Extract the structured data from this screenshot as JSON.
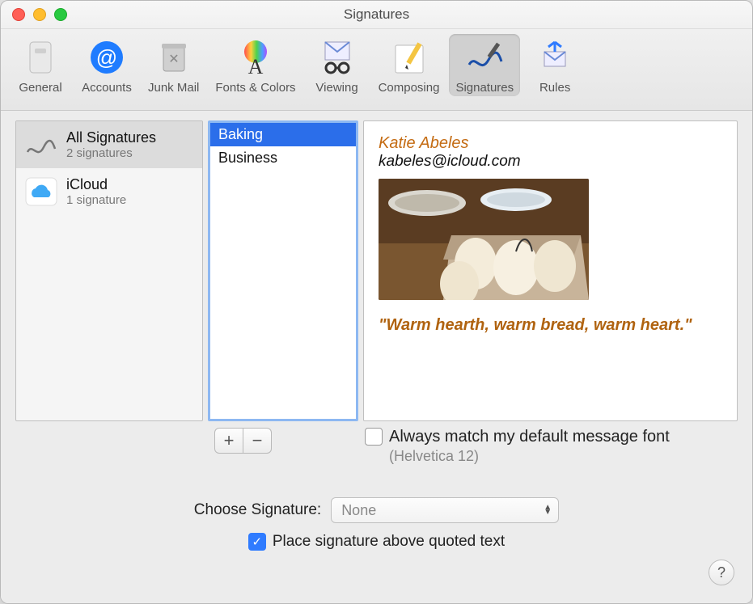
{
  "window": {
    "title": "Signatures"
  },
  "toolbar": {
    "items": [
      {
        "label": "General"
      },
      {
        "label": "Accounts"
      },
      {
        "label": "Junk Mail"
      },
      {
        "label": "Fonts & Colors"
      },
      {
        "label": "Viewing"
      },
      {
        "label": "Composing"
      },
      {
        "label": "Signatures"
      },
      {
        "label": "Rules"
      }
    ],
    "selected_index": 6
  },
  "accounts_column": {
    "rows": [
      {
        "title": "All Signatures",
        "subtitle": "2 signatures",
        "selected": true,
        "icon": "signature"
      },
      {
        "title": "iCloud",
        "subtitle": "1 signature",
        "selected": false,
        "icon": "icloud"
      }
    ]
  },
  "signatures_column": {
    "items": [
      {
        "name": "Baking",
        "selected": true
      },
      {
        "name": "Business",
        "selected": false
      }
    ]
  },
  "preview": {
    "name": "Katie Abeles",
    "email": "kabeles@icloud.com",
    "quote": "\"Warm hearth, warm bread, warm heart.\""
  },
  "always_match": {
    "checked": false,
    "label": "Always match my default message font",
    "sublabel": "(Helvetica 12)"
  },
  "choose_signature": {
    "label": "Choose Signature:",
    "value": "None"
  },
  "place_above": {
    "checked": true,
    "label": "Place signature above quoted text"
  },
  "buttons": {
    "add": "+",
    "remove": "−"
  },
  "colors": {
    "accent_blue": "#2f7bff",
    "brown_text": "#b06310"
  }
}
